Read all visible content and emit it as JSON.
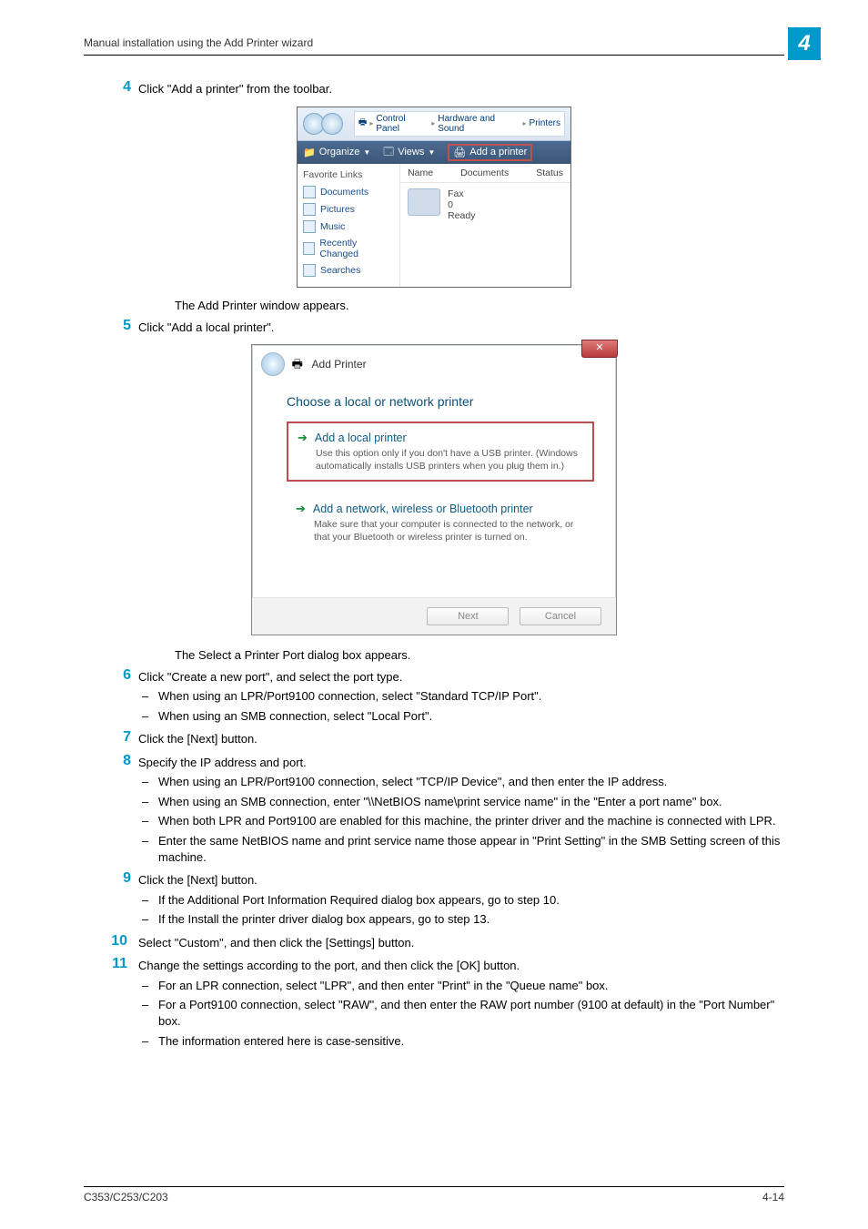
{
  "page": {
    "section_title": "Manual installation using the Add Printer wizard",
    "chapter_badge": "4",
    "footer_model": "C353/C253/C203",
    "footer_page": "4-14"
  },
  "steps": {
    "s4": {
      "num": "4",
      "body": "Click \"Add a printer\" from the toolbar."
    },
    "after4": "The Add Printer window appears.",
    "s5": {
      "num": "5",
      "body": "Click \"Add a local printer\"."
    },
    "after5": "The Select a Printer Port dialog box appears.",
    "s6": {
      "num": "6",
      "body": "Click \"Create a new port\", and select the port type.",
      "items": [
        "When using an LPR/Port9100 connection, select \"Standard TCP/IP Port\".",
        "When using an SMB connection, select \"Local Port\"."
      ]
    },
    "s7": {
      "num": "7",
      "body": "Click the [Next] button."
    },
    "s8": {
      "num": "8",
      "body": "Specify the IP address and port.",
      "items": [
        "When using an LPR/Port9100 connection, select \"TCP/IP Device\", and then enter the IP address.",
        "When using an SMB connection, enter \"\\\\NetBIOS name\\print service name\" in the \"Enter a port name\" box.",
        "When both LPR and Port9100 are enabled for this machine, the printer driver and the machine is connected with LPR.",
        "Enter the same NetBIOS name and print service name those appear in \"Print Setting\" in the SMB Setting screen of this machine."
      ]
    },
    "s9": {
      "num": "9",
      "body": "Click the [Next] button.",
      "items": [
        "If the Additional Port Information Required dialog box appears, go to step 10.",
        "If the Install the printer driver dialog box appears, go to step 13."
      ]
    },
    "s10": {
      "num": "10",
      "body": "Select \"Custom\", and then click the [Settings] button."
    },
    "s11": {
      "num": "11",
      "body": "Change the settings according to the port, and then click the [OK] button.",
      "items": [
        "For an LPR connection, select \"LPR\", and then enter \"Print\" in the \"Queue name\" box.",
        "For a Port9100 connection, select \"RAW\", and then enter the RAW port number (9100 at default) in the \"Port Number\" box.",
        "The information entered here is case-sensitive."
      ]
    }
  },
  "shot1": {
    "crumb1": "Control Panel",
    "crumb2": "Hardware and Sound",
    "crumb3": "Printers",
    "tb_organize": "Organize",
    "tb_views": "Views",
    "tb_add": "Add a printer",
    "fav_hdr": "Favorite Links",
    "links": [
      "Documents",
      "Pictures",
      "Music",
      "Recently Changed",
      "Searches"
    ],
    "col_name": "Name",
    "col_docs": "Documents",
    "col_status": "Status",
    "printer": {
      "name": "Fax",
      "docs": "0",
      "status": "Ready"
    }
  },
  "shot2": {
    "title": "Add Printer",
    "close": "✕",
    "heading": "Choose a local or network printer",
    "opt1_title": "Add a local printer",
    "opt1_desc": "Use this option only if you don't have a USB printer. (Windows automatically installs USB printers when you plug them in.)",
    "opt2_title": "Add a network, wireless or Bluetooth printer",
    "opt2_desc": "Make sure that your computer is connected to the network, or that your Bluetooth or wireless printer is turned on.",
    "next": "Next",
    "cancel": "Cancel"
  }
}
